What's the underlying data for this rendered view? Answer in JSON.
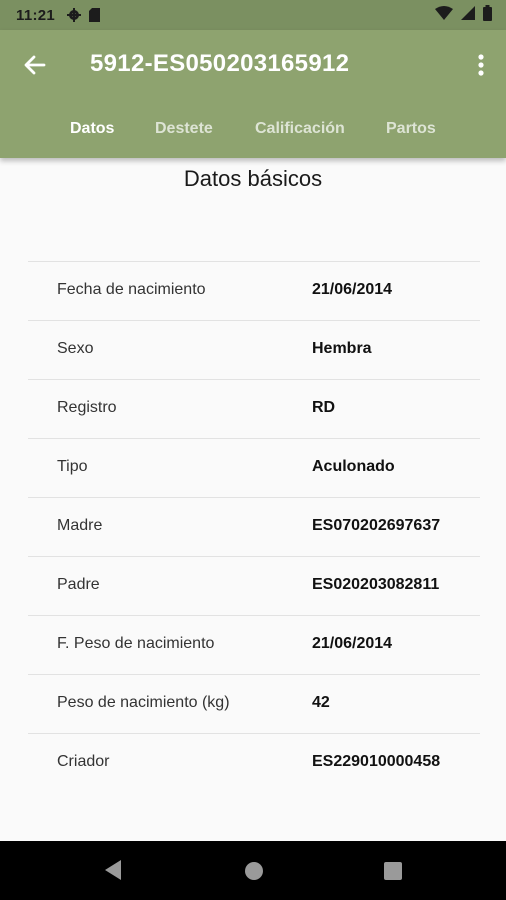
{
  "status": {
    "time": "11:21"
  },
  "header": {
    "title": "5912-ES050203165912"
  },
  "tabs": [
    {
      "label": "Datos"
    },
    {
      "label": "Destete"
    },
    {
      "label": "Calificación"
    },
    {
      "label": "Partos"
    }
  ],
  "section": {
    "title": "Datos básicos"
  },
  "rows": [
    {
      "label": "Fecha de nacimiento",
      "value": "21/06/2014"
    },
    {
      "label": "Sexo",
      "value": "Hembra"
    },
    {
      "label": "Registro",
      "value": "RD"
    },
    {
      "label": "Tipo",
      "value": "Aculonado"
    },
    {
      "label": "Madre",
      "value": "ES070202697637"
    },
    {
      "label": "Padre",
      "value": "ES020203082811"
    },
    {
      "label": "F. Peso de nacimiento",
      "value": "21/06/2014"
    },
    {
      "label": "Peso de nacimiento (kg)",
      "value": "42"
    },
    {
      "label": "Criador",
      "value": "ES229010000458"
    }
  ],
  "colors": {
    "statusbar": "#7b9061",
    "appbar": "#8ea36f",
    "navbar": "#000000",
    "background": "#fafafa"
  },
  "icons": [
    "gear-icon",
    "sd-card-icon",
    "wifi-icon",
    "signal-icon",
    "battery-icon",
    "back-arrow-icon",
    "more-vert-icon",
    "nav-back-icon",
    "nav-home-icon",
    "nav-recents-icon"
  ]
}
